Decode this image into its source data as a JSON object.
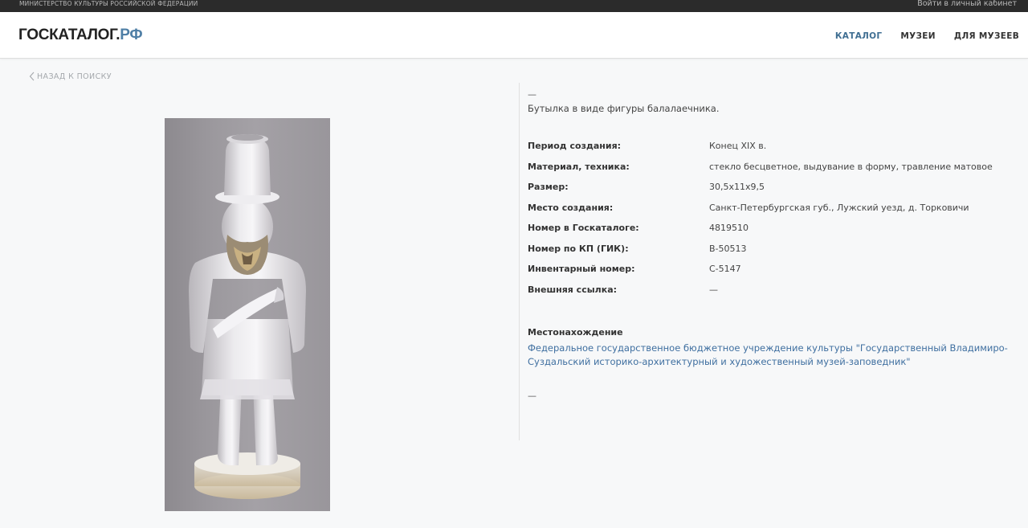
{
  "topbar": {
    "ministry": "МИНИСТЕРСТВО КУЛЬТУРЫ РОССИЙСКОЙ ФЕДЕРАЦИИ",
    "cabinet_link": "Войти в личный кабинет"
  },
  "header": {
    "logo_main": "ГОСКАТАЛОГ.",
    "logo_suffix": "РФ",
    "nav": [
      {
        "label": "КАТАЛОГ",
        "active": true
      },
      {
        "label": "МУЗЕИ",
        "active": false
      },
      {
        "label": "ДЛЯ МУЗЕЕВ",
        "active": false
      }
    ]
  },
  "back_link": "НАЗАД К ПОИСКУ",
  "item": {
    "top_dash": "—",
    "title": "Бутылка в виде фигуры балалаечника.",
    "properties": [
      {
        "label": "Период создания:",
        "value": "Конец XIX в."
      },
      {
        "label": "Материал, техника:",
        "value": "стекло бесцветное, выдувание в форму, травление матовое"
      },
      {
        "label": "Размер:",
        "value": "30,5х11х9,5"
      },
      {
        "label": "Место создания:",
        "value": "Санкт-Петербургская губ., Лужский уезд, д. Торковичи"
      },
      {
        "label": "Номер в Госкаталоге:",
        "value": "4819510"
      },
      {
        "label": "Номер по КП (ГИК):",
        "value": "В-50513"
      },
      {
        "label": "Инвентарный номер:",
        "value": "С-5147"
      },
      {
        "label": "Внешняя ссылка:",
        "value": "—"
      }
    ],
    "location_label": "Местонахождение",
    "location_value": "Федеральное государственное бюджетное учреждение культуры \"Государственный Владимиро-Суздальский историко-архитектурный и художественный музей-заповедник\"",
    "bottom_dash": "—"
  },
  "colors": {
    "topbar_bg": "#2b2b2b",
    "accent": "#3f6e92",
    "link": "#3f6fa0"
  }
}
